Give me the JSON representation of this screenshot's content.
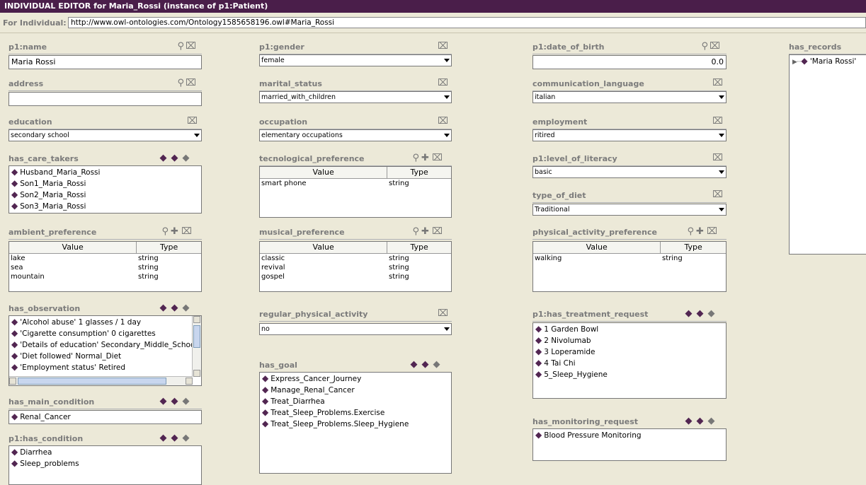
{
  "window": {
    "title": "INDIVIDUAL EDITOR for Maria_Rossi   (instance of p1:Patient)",
    "for_individual_label": "For Individual:",
    "for_individual_value": "http://www.owl-ontologies.com/Ontology1585658196.owl#Maria_Rossi"
  },
  "colors": {
    "title_bg": "#4a1e4a",
    "diamond": "#522652",
    "background": "#ece9d8"
  },
  "col1": {
    "p1_name": {
      "label": "p1:name",
      "value": "Maria Rossi"
    },
    "address": {
      "label": "address",
      "value": ""
    },
    "education": {
      "label": "education",
      "value": "secondary school"
    },
    "has_care_takers": {
      "label": "has_care_takers",
      "items": [
        "Husband_Maria_Rossi",
        "Son1_Maria_Rossi",
        "Son2_Maria_Rossi",
        "Son3_Maria_Rossi"
      ]
    },
    "ambient_preference": {
      "label": "ambient_preference",
      "col_value": "Value",
      "col_type": "Type",
      "rows": [
        {
          "value": "lake",
          "type": "string"
        },
        {
          "value": "sea",
          "type": "string"
        },
        {
          "value": "mountain",
          "type": "string"
        }
      ]
    },
    "has_observation": {
      "label": "has_observation",
      "items": [
        "'Alcohol abuse' 1 glasses / 1 day",
        "'Cigarette consumption' 0 cigarettes",
        "'Details of education' Secondary_Middle_Schoo",
        "'Diet followed' Normal_Diet",
        "'Employment status' Retired"
      ]
    },
    "has_main_condition": {
      "label": "has_main_condition",
      "items": [
        "Renal_Cancer"
      ]
    },
    "p1_has_condition": {
      "label": "p1:has_condition",
      "items": [
        "Diarrhea",
        "Sleep_problems"
      ]
    }
  },
  "col2": {
    "p1_gender": {
      "label": "p1:gender",
      "value": "female"
    },
    "marital_status": {
      "label": "marital_status",
      "value": "married_with_children"
    },
    "occupation": {
      "label": "occupation",
      "value": "elementary occupations"
    },
    "tecnological_preference": {
      "label": "tecnological_preference",
      "col_value": "Value",
      "col_type": "Type",
      "rows": [
        {
          "value": "smart phone",
          "type": "string"
        }
      ]
    },
    "musical_preference": {
      "label": "musical_preference",
      "col_value": "Value",
      "col_type": "Type",
      "rows": [
        {
          "value": "classic",
          "type": "string"
        },
        {
          "value": "revival",
          "type": "string"
        },
        {
          "value": "gospel",
          "type": "string"
        }
      ]
    },
    "regular_physical_activity": {
      "label": "regular_physical_activity",
      "value": "no"
    },
    "has_goal": {
      "label": "has_goal",
      "items": [
        "Express_Cancer_Journey",
        "Manage_Renal_Cancer",
        "Treat_Diarrhea",
        "Treat_Sleep_Problems.Exercise",
        "Treat_Sleep_Problems.Sleep_Hygiene"
      ]
    }
  },
  "col3": {
    "p1_date_of_birth": {
      "label": "p1:date_of_birth",
      "value": "0.0"
    },
    "communication_language": {
      "label": "communication_language",
      "value": "italian"
    },
    "employment": {
      "label": "employment",
      "value": "ritired"
    },
    "p1_level_of_literacy": {
      "label": "p1:level_of_literacy",
      "value": "basic"
    },
    "type_of_diet": {
      "label": "type_of_diet",
      "value": "Traditional"
    },
    "physical_activity_preference": {
      "label": "physical_activity_preference",
      "col_value": "Value",
      "col_type": "Type",
      "rows": [
        {
          "value": "walking",
          "type": "string"
        }
      ]
    },
    "p1_has_treatment_request": {
      "label": "p1:has_treatment_request",
      "items": [
        "1 Garden Bowl",
        "2 Nivolumab",
        "3 Loperamide",
        "4 Tai Chi",
        "5_Sleep_Hygiene"
      ]
    },
    "has_monitoring_request": {
      "label": "has_monitoring_request",
      "items": [
        "Blood Pressure Monitoring"
      ]
    }
  },
  "col4": {
    "has_records": {
      "label": "has_records",
      "items": [
        "'Maria Rossi'"
      ]
    }
  },
  "icons": {
    "find": "magnifier-icon",
    "delete": "delete-x-icon",
    "create": "create-instance-icon",
    "add": "add-instance-icon",
    "remove": "remove-instance-icon",
    "add_value": "plus-icon"
  }
}
